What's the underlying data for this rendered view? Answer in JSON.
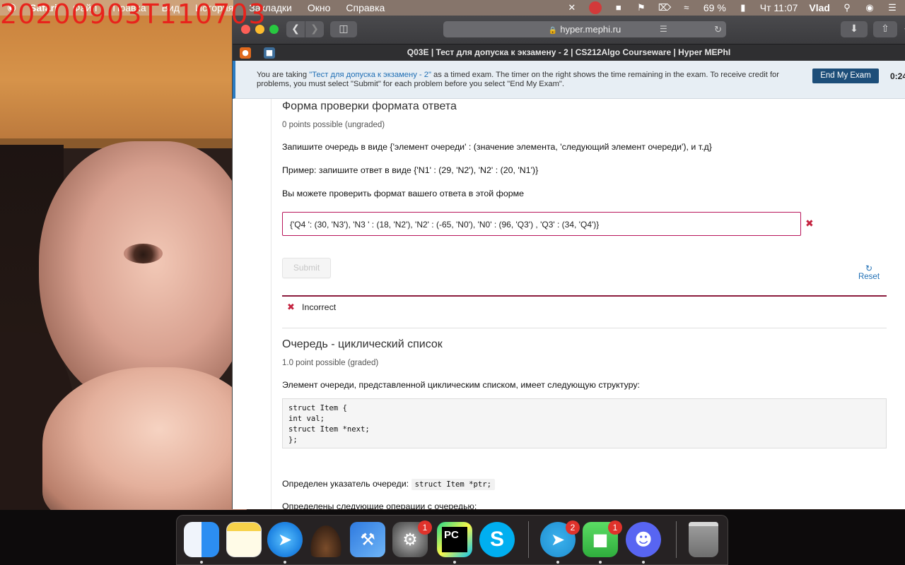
{
  "overlay": {
    "timestamp": "20200903T110703"
  },
  "menubar": {
    "apple": "",
    "items": [
      "Safari",
      "Файл",
      "Правка",
      "Вид",
      "История",
      "Закладки",
      "Окно",
      "Справка"
    ],
    "battery": "69 %",
    "clock": "Чт 11:07",
    "user": "Vlad"
  },
  "browser": {
    "url": "hyper.mephi.ru",
    "tab_title": "Q03E | Тест для допуска к экзамену - 2 | CS212Algo Courseware | Hyper MEPhI"
  },
  "exam_banner": {
    "prefix": "You are taking ",
    "exam_link": "\"Тест для допуска к экзамену - 2\"",
    "suffix": " as a timed exam. The timer on the right shows the time remaining in the exam. To receive credit for problems, you must select \"Submit\" for each problem before you select \"End My Exam\".",
    "end_button": "End My Exam",
    "timer": "0:24:"
  },
  "problem1": {
    "title": "Форма проверки формата ответа",
    "points": "0 points possible (ungraded)",
    "line1": "Запишите очередь в виде {'элемент очереди' : (значение элемента, 'следующий элемент очереди'), и т.д}",
    "line2": "Пример: запишите ответ в виде {'N1' : (29, 'N2'), 'N2' : (20, 'N1')}",
    "line3": "Вы можете проверить формат вашего ответа в этой форме",
    "answer": "{'Q4 ': (30, 'N3'), 'N3 ' : (18, 'N2'), 'N2' : (-65, 'N0'), 'N0' : (96, 'Q3') , 'Q3' : (34, 'Q4')}",
    "submit": "Submit",
    "reset": "Reset",
    "feedback": "Incorrect"
  },
  "problem2": {
    "title": "Очередь - циклический список",
    "points": "1.0 point possible (graded)",
    "intro": "Элемент очереди, представленной циклическим списком, имеет следующую структуру:",
    "code": [
      "struct Item {",
      "int val;",
      "struct Item *next;",
      "};"
    ],
    "pointer_label": "Определен указатель очереди:",
    "pointer_code": "struct Item *ptr;",
    "operations_label": "Определены следующие операции с очередью:"
  },
  "dock": {
    "badges": {
      "prefs": "1",
      "telegram": "2",
      "facetime": "1"
    }
  },
  "colors": {
    "accent": "#1f6fb5",
    "error": "#c4223f",
    "end_exam": "#1d4e79"
  }
}
